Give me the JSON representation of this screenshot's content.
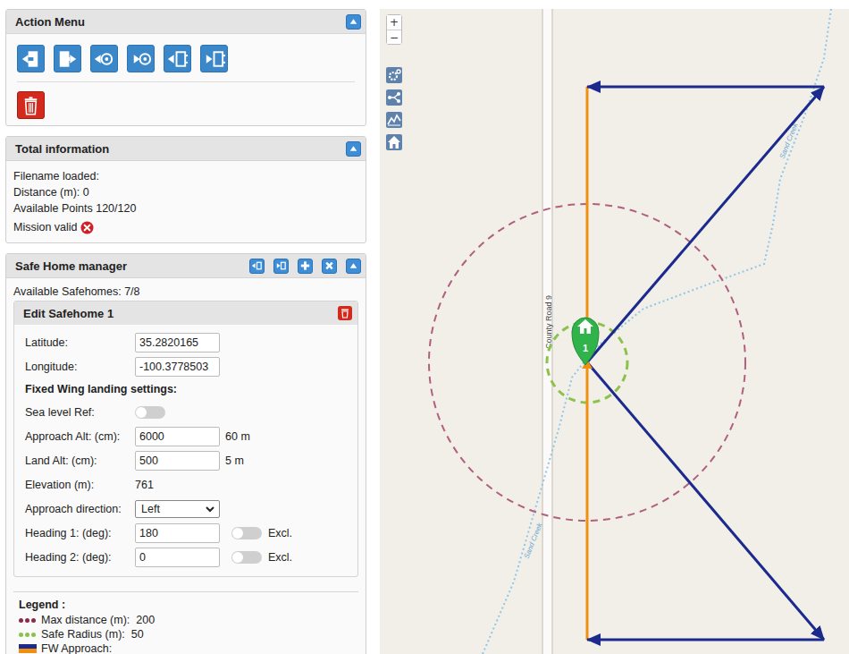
{
  "action_menu": {
    "title": "Action Menu",
    "expanded": true
  },
  "total_information": {
    "title": "Total information",
    "expanded": true,
    "lines": [
      "Filename loaded:",
      "Distance (m): 0",
      "Available Points 120/120"
    ],
    "mission_valid": {
      "label": "Mission valid",
      "valid": false
    }
  },
  "safe_home_manager": {
    "title": "Safe Home manager",
    "expanded": true,
    "available": "Available Safehomes: 7/8",
    "editor": {
      "title": "Edit Safehome 1",
      "fields": [
        {
          "kind": "input",
          "label": "Latitude:",
          "value": "35.2820165"
        },
        {
          "kind": "input",
          "label": "Longitude:",
          "value": "-100.3778503"
        },
        {
          "kind": "heading",
          "label": "Fixed Wing landing settings:"
        },
        {
          "kind": "toggle",
          "label": "Sea level Ref:",
          "on": false
        },
        {
          "kind": "input",
          "label": "Approach Alt: (cm):",
          "value": "6000",
          "unit": "60 m"
        },
        {
          "kind": "input",
          "label": "Land Alt: (cm):",
          "value": "500",
          "unit": "5 m"
        },
        {
          "kind": "text",
          "label": "Elevation (m):",
          "value": "761"
        },
        {
          "kind": "select",
          "label": "Approach direction:",
          "value": "Left"
        },
        {
          "kind": "input_toggle",
          "label": "Heading 1: (deg):",
          "value": "180",
          "toggle_label": "Excl.",
          "on": false
        },
        {
          "kind": "input_toggle",
          "label": "Heading 2: (deg):",
          "value": "0",
          "toggle_label": "Excl.",
          "on": false
        }
      ]
    },
    "legend": {
      "title": "Legend :",
      "items": [
        {
          "kind": "dots",
          "label": "Max distance (m):  200",
          "color": "#8b2b47"
        },
        {
          "kind": "dots",
          "label": "Safe Radius (m):  50",
          "color": "#8bc34a"
        },
        {
          "kind": "swatch",
          "label": "FW Approach:",
          "color": "#f0900f"
        }
      ]
    }
  },
  "map": {
    "zoom_in": "+",
    "zoom_out": "−",
    "road_label": "County Road 9",
    "creek_labels": [
      "Sand Creek",
      "Sand Creek"
    ],
    "safehome_marker": "1"
  }
}
